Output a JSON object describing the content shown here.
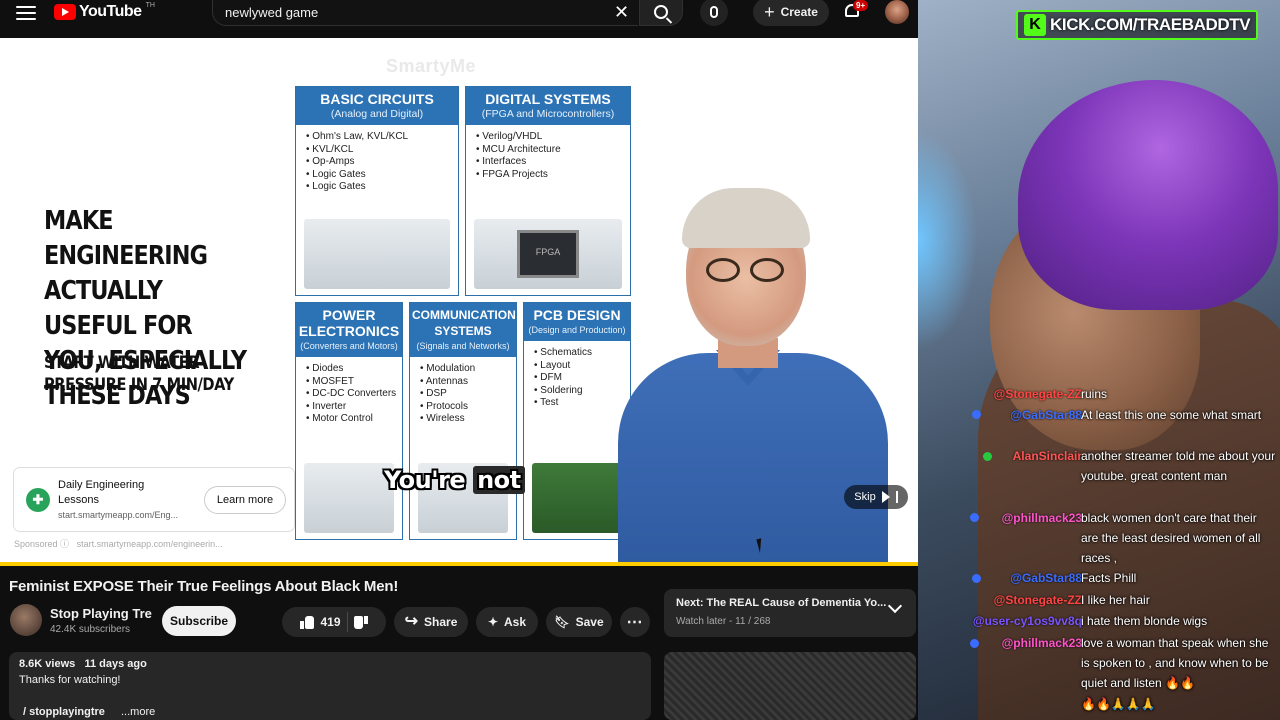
{
  "youtube": {
    "logo_text": "YouTube",
    "logo_region": "TH",
    "search_query": "newlywed game",
    "create_label": "Create",
    "notification_count": "9+"
  },
  "ad": {
    "watermark": "SmartyMe",
    "headline": "MAKE ENGINEERING ACTUALLY USEFUL FOR YOU, ESPECIALLY THESE DAYS",
    "subline": "START WITH WATER PRESSURE IN 7 MIN/DAY",
    "cards": [
      {
        "title": "BASIC CIRCUITS",
        "subtitle": "(Analog and Digital)",
        "items": [
          "Ohm's Law, KVL/KCL",
          "KVL/KCL",
          "Op-Amps",
          "Logic Gates",
          "Logic Gates"
        ]
      },
      {
        "title": "DIGITAL SYSTEMS",
        "subtitle": "(FPGA and Microcontrollers)",
        "items": [
          "Verilog/VHDL",
          "MCU Architecture",
          "Interfaces",
          "FPGA Projects"
        ],
        "chip_label": "FPGA"
      },
      {
        "title": "POWER ELECTRONICS",
        "subtitle": "(Converters and Motors)",
        "items": [
          "Diodes",
          "MOSFET",
          "DC-DC Converters",
          "Inverter",
          "Motor Control"
        ]
      },
      {
        "title": "COMMUNICATION SYSTEMS",
        "subtitle": "(Signals and Networks)",
        "items": [
          "Modulation",
          "Antennas",
          "DSP",
          "Protocols",
          "Wireless"
        ]
      },
      {
        "title": "PCB DESIGN",
        "subtitle": "(Design and Production)",
        "items": [
          "Schematics",
          "Layout",
          "DFM",
          "Soldering",
          "Test"
        ]
      }
    ],
    "caption_a": "You're",
    "caption_b": "not",
    "advertiser_title": "Daily Engineering Lessons",
    "advertiser_url": "start.smartymeapp.com/Eng...",
    "learn_more": "Learn more",
    "sponsored_label": "Sponsored",
    "sponsored_url": "start.smartymeapp.com/engineerin...",
    "skip_label": "Skip"
  },
  "video": {
    "title": "Feminist EXPOSE Their True Feelings About Black Men!",
    "channel_name": "Stop Playing Tre",
    "subscribers": "42.4K subscribers",
    "subscribe_label": "Subscribe",
    "likes": "419",
    "share_label": "Share",
    "ask_label": "Ask",
    "save_label": "Save",
    "views": "8.6K views",
    "age": "11 days ago",
    "description": "Thanks for watching!",
    "desc_link": "/ stopplayingtre",
    "desc_more": "...more"
  },
  "next_up": {
    "title": "Next: The REAL Cause of Dementia Yo...",
    "subtitle": "Watch later - 11 / 268"
  },
  "stream": {
    "kick_url": "KICK.COM/TRAEBADDTV",
    "chat": [
      {
        "user": "@Stonegate-ZZ",
        "color": "#ff4444",
        "text": "ruins"
      },
      {
        "user": "@GabStar88",
        "color": "#3a6cff",
        "text": "At least this one some what smart"
      },
      {
        "user": "AlanSinclair",
        "color": "#ff5555",
        "text": "another streamer told me about your youtube. great content man"
      },
      {
        "user": "@phillmack23",
        "color": "#ff55cc",
        "text": "black women don't care that their are the least desired women of all races ,"
      },
      {
        "user": "@GabStar88",
        "color": "#3a6cff",
        "text": "Facts Phill"
      },
      {
        "user": "@Stonegate-ZZ",
        "color": "#ff4444",
        "text": "I like her hair"
      },
      {
        "user": "@user-cy1os9vv8q",
        "color": "#7a55ff",
        "text": "i hate them blonde wigs"
      },
      {
        "user": "@phillmack23",
        "color": "#ff55cc",
        "text": "love a woman that speak when she is spoken to , and know when to be quiet and listen 🔥🔥"
      },
      {
        "user": "",
        "color": "#ffffff",
        "text": "🔥🔥🙏🙏🙏"
      }
    ]
  }
}
